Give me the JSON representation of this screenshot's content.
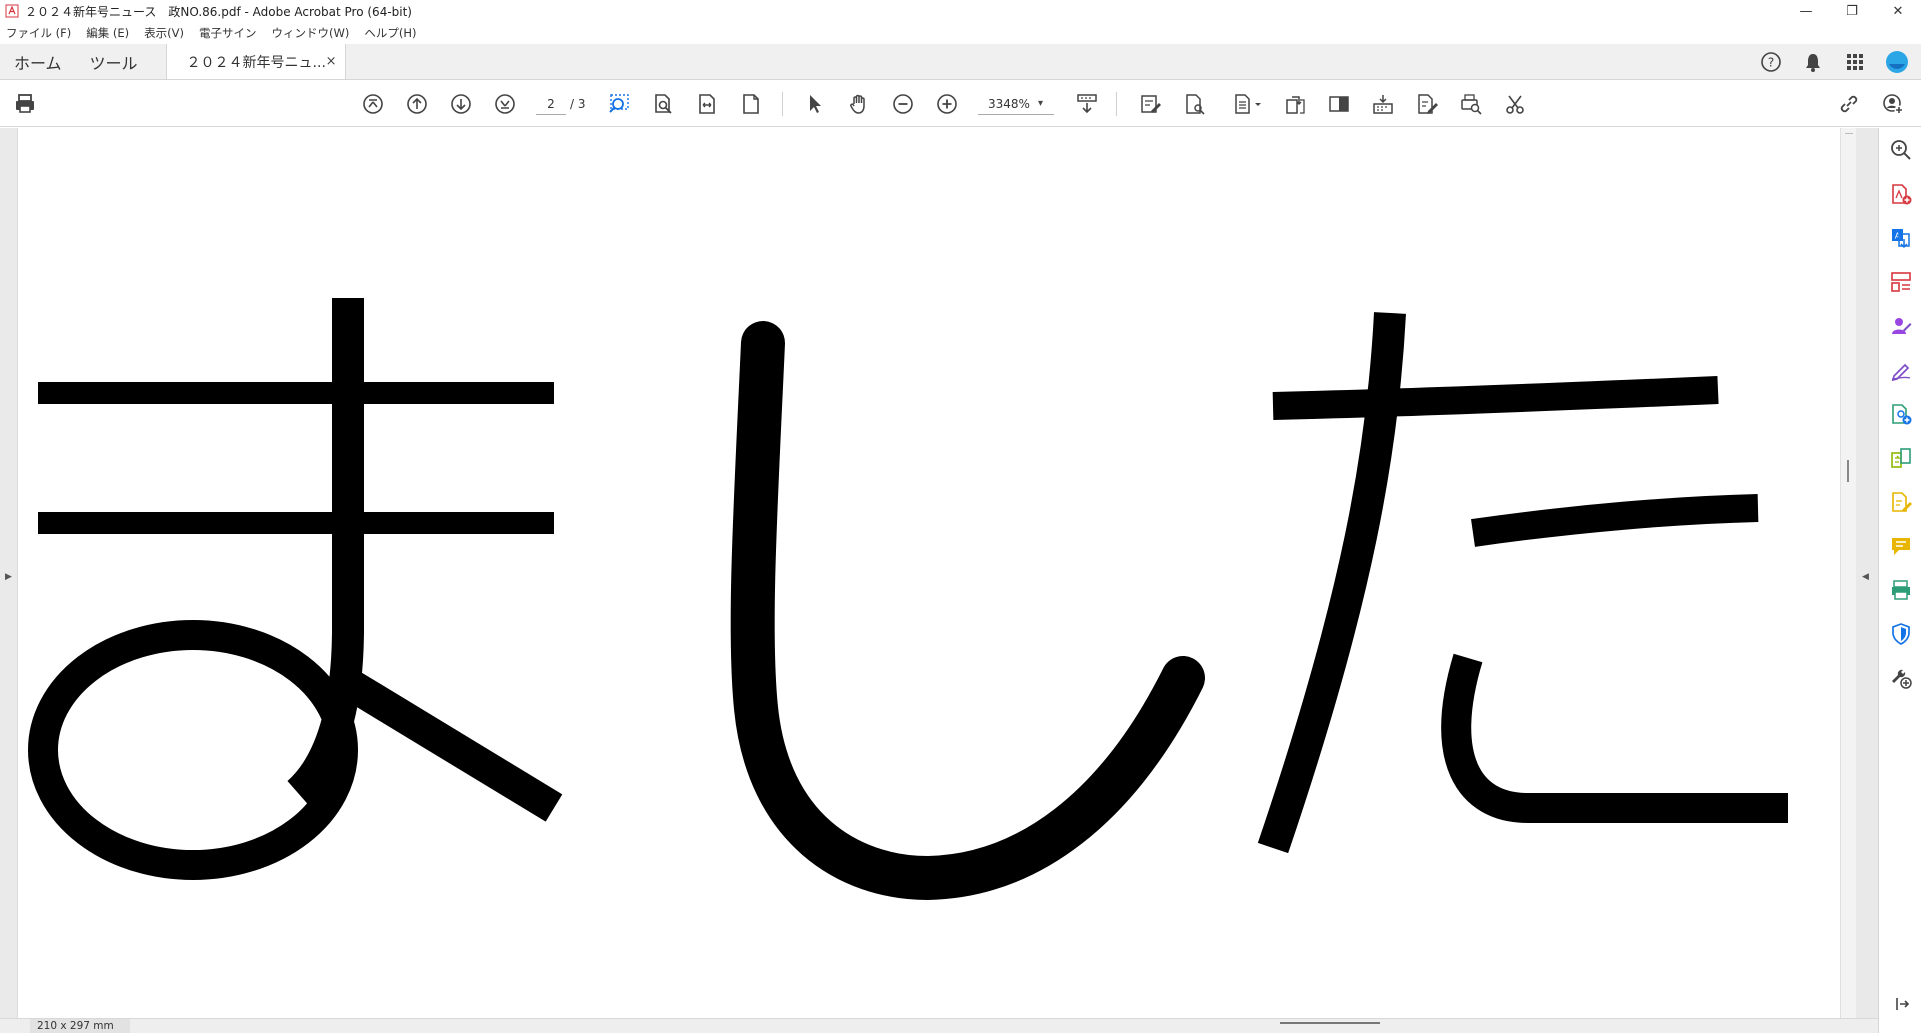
{
  "window": {
    "title": "２０２４新年号ニュース　政NO.86.pdf - Adobe Acrobat Pro (64-bit)",
    "minimize": "—",
    "restore": "❐",
    "close": "✕"
  },
  "menu": {
    "items": [
      "ファイル (F)",
      "編集 (E)",
      "表示(V)",
      "電子サイン",
      "ウィンドウ(W)",
      "ヘルプ(H)"
    ]
  },
  "tabs": {
    "home": "ホーム",
    "tools": "ツール",
    "document": "２０２４新年号ニュ...",
    "close": "×"
  },
  "toolbar": {
    "current_page": "2",
    "total_pages": "/ 3",
    "zoom": "3348%",
    "zoom_caret": "▾"
  },
  "status": {
    "page_size": "210 x 297 mm"
  },
  "page_text": {
    "visible": "ました"
  },
  "colors": {
    "accent_blue": "#1473e6",
    "export_red": "#d7373f",
    "comment_yellow": "#e8b600",
    "edit_purple": "#9a47e2",
    "print_green": "#2d9d78",
    "sign_violet": "#7e4fc7"
  },
  "icons": {
    "toolbar": [
      "print-icon",
      "first-page-icon",
      "previous-page-icon",
      "next-page-icon",
      "last-page-icon",
      "marquee-zoom-icon",
      "find-icon",
      "fit-width-icon",
      "fit-page-icon",
      "select-tool-icon",
      "hand-tool-icon",
      "zoom-out-icon",
      "zoom-in-icon",
      "scroll-mode-icon",
      "fill-sign-icon",
      "protect-icon",
      "organize-pages-icon",
      "rotate-icon",
      "redact-icon",
      "stamp-icon",
      "edit-pdf-icon",
      "print-production-icon",
      "cut-icon",
      "share-link-icon",
      "add-account-icon"
    ],
    "right_pane": [
      "zoom-search-icon",
      "create-pdf-icon",
      "export-pdf-icon",
      "organize-icon",
      "request-signature-icon",
      "fill-sign-icon",
      "enhance-scan-icon",
      "compare-icon",
      "edit-pdf-icon",
      "comment-icon",
      "print-production-icon",
      "protect-icon",
      "more-tools-icon",
      "collapse-pane-icon"
    ]
  }
}
